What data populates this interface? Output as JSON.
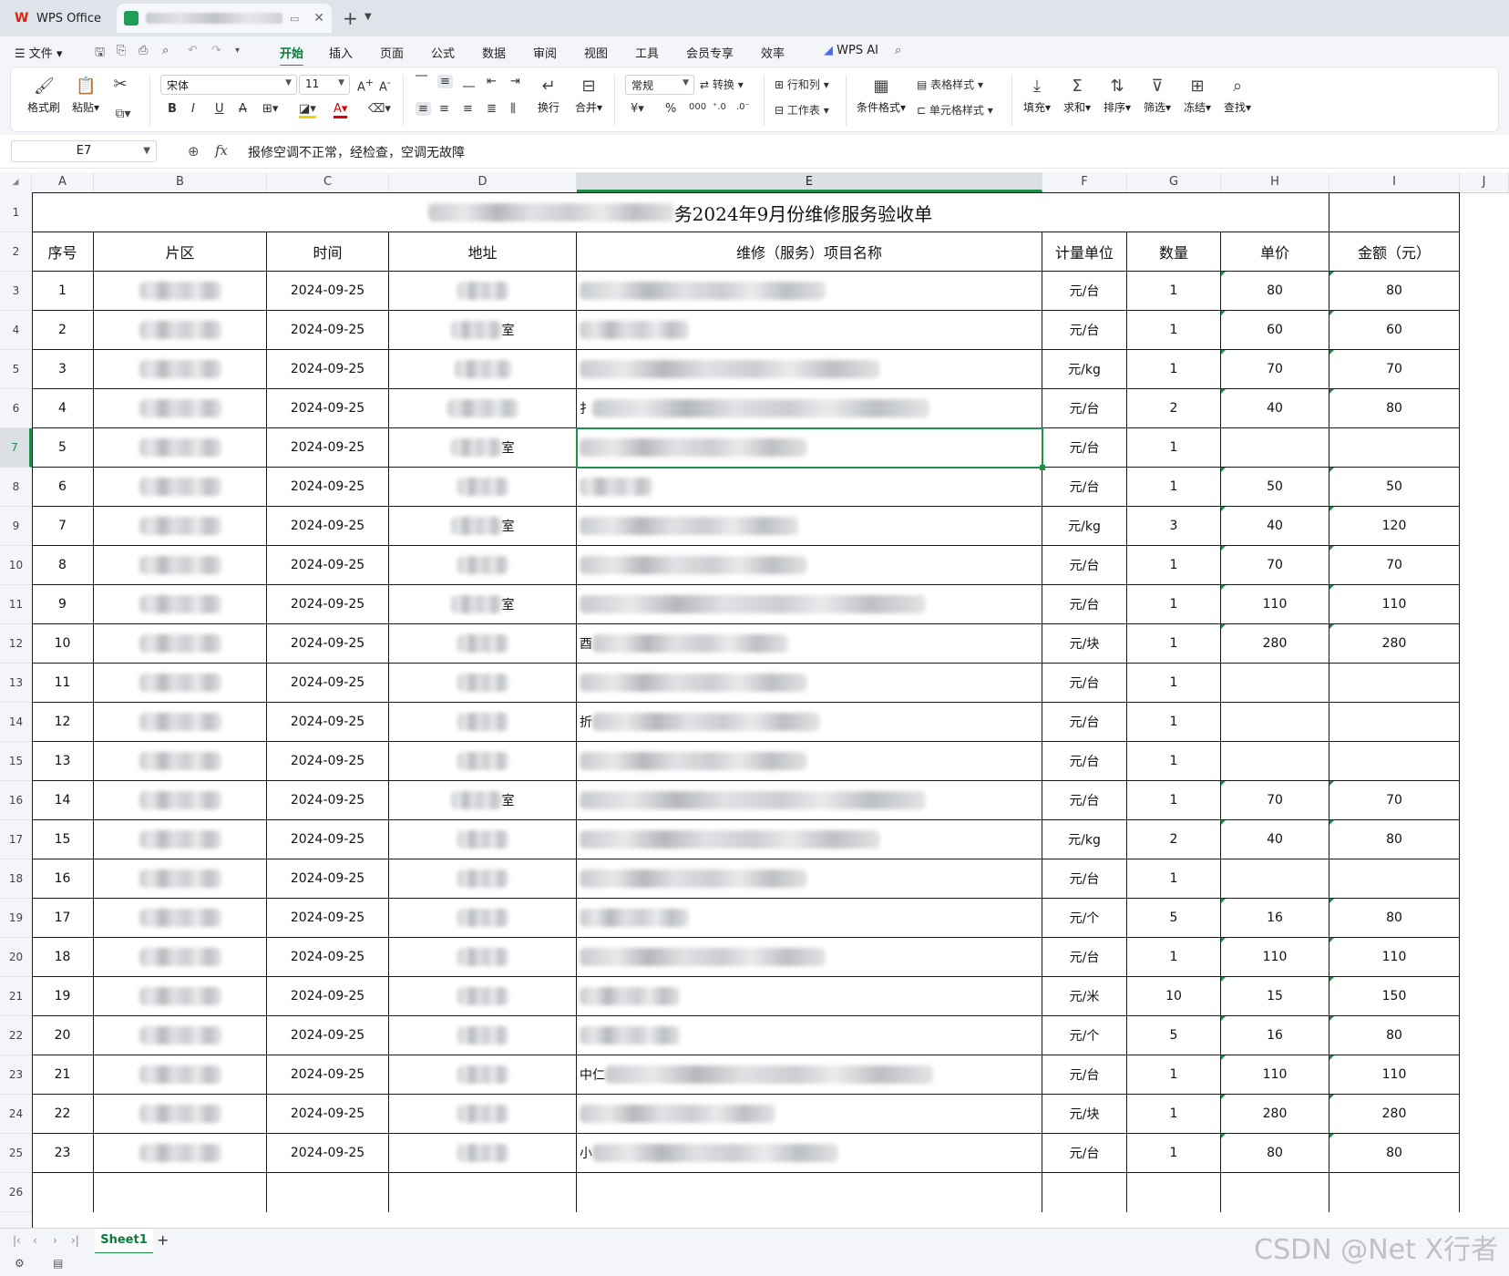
{
  "tabs": {
    "app": "WPS Office"
  },
  "menu": [
    "文件",
    "开始",
    "插入",
    "页面",
    "公式",
    "数据",
    "审阅",
    "视图",
    "工具",
    "会员专享",
    "效率",
    "WPS AI"
  ],
  "ribbon": {
    "format_painter": "格式刷",
    "paste": "粘贴",
    "font_name": "宋体",
    "font_size": "11",
    "wrap": "换行",
    "merge": "合并",
    "number_format": "常规",
    "convert": "转换",
    "rows_cols": "行和列",
    "worksheet": "工作表",
    "cond_format": "条件格式",
    "table_style": "表格样式",
    "cell_style": "单元格样式",
    "fill": "填充",
    "sum": "求和",
    "sort": "排序",
    "filter": "筛选",
    "freeze": "冻结",
    "find": "查找"
  },
  "formula": {
    "cell": "E7",
    "content": "报修空调不正常，经检查，空调无故障"
  },
  "columns": [
    "A",
    "B",
    "C",
    "D",
    "E",
    "F",
    "G",
    "H",
    "I",
    "J"
  ],
  "sheet": {
    "title_visible": "务2024年9月份维修服务验收单",
    "headers": [
      "序号",
      "片区",
      "时间",
      "地址",
      "维修（服务）项目名称",
      "计量单位",
      "数量",
      "单价",
      "金额（元）"
    ],
    "rows": [
      {
        "n": "1",
        "date": "2024-09-25",
        "unit": "元/台",
        "qty": "1",
        "price": "80",
        "amount": "80"
      },
      {
        "n": "2",
        "date": "2024-09-25",
        "unit": "元/台",
        "qty": "1",
        "price": "60",
        "amount": "60"
      },
      {
        "n": "3",
        "date": "2024-09-25",
        "unit": "元/kg",
        "qty": "1",
        "price": "70",
        "amount": "70"
      },
      {
        "n": "4",
        "date": "2024-09-25",
        "unit": "元/台",
        "qty": "2",
        "price": "40",
        "amount": "80"
      },
      {
        "n": "5",
        "date": "2024-09-25",
        "unit": "元/台",
        "qty": "1",
        "price": "",
        "amount": ""
      },
      {
        "n": "6",
        "date": "2024-09-25",
        "unit": "元/台",
        "qty": "1",
        "price": "50",
        "amount": "50"
      },
      {
        "n": "7",
        "date": "2024-09-25",
        "unit": "元/kg",
        "qty": "3",
        "price": "40",
        "amount": "120"
      },
      {
        "n": "8",
        "date": "2024-09-25",
        "unit": "元/台",
        "qty": "1",
        "price": "70",
        "amount": "70"
      },
      {
        "n": "9",
        "date": "2024-09-25",
        "unit": "元/台",
        "qty": "1",
        "price": "110",
        "amount": "110"
      },
      {
        "n": "10",
        "date": "2024-09-25",
        "unit": "元/块",
        "qty": "1",
        "price": "280",
        "amount": "280"
      },
      {
        "n": "11",
        "date": "2024-09-25",
        "unit": "元/台",
        "qty": "1",
        "price": "",
        "amount": ""
      },
      {
        "n": "12",
        "date": "2024-09-25",
        "unit": "元/台",
        "qty": "1",
        "price": "",
        "amount": ""
      },
      {
        "n": "13",
        "date": "2024-09-25",
        "unit": "元/台",
        "qty": "1",
        "price": "",
        "amount": ""
      },
      {
        "n": "14",
        "date": "2024-09-25",
        "unit": "元/台",
        "qty": "1",
        "price": "70",
        "amount": "70"
      },
      {
        "n": "15",
        "date": "2024-09-25",
        "unit": "元/kg",
        "qty": "2",
        "price": "40",
        "amount": "80"
      },
      {
        "n": "16",
        "date": "2024-09-25",
        "unit": "元/台",
        "qty": "1",
        "price": "",
        "amount": ""
      },
      {
        "n": "17",
        "date": "2024-09-25",
        "unit": "元/个",
        "qty": "5",
        "price": "16",
        "amount": "80"
      },
      {
        "n": "18",
        "date": "2024-09-25",
        "unit": "元/台",
        "qty": "1",
        "price": "110",
        "amount": "110"
      },
      {
        "n": "19",
        "date": "2024-09-25",
        "unit": "元/米",
        "qty": "10",
        "price": "15",
        "amount": "150"
      },
      {
        "n": "20",
        "date": "2024-09-25",
        "unit": "元/个",
        "qty": "5",
        "price": "16",
        "amount": "80"
      },
      {
        "n": "21",
        "date": "2024-09-25",
        "unit": "元/台",
        "qty": "1",
        "price": "110",
        "amount": "110"
      },
      {
        "n": "22",
        "date": "2024-09-25",
        "unit": "元/块",
        "qty": "1",
        "price": "280",
        "amount": "280"
      },
      {
        "n": "23",
        "date": "2024-09-25",
        "unit": "元/台",
        "qty": "1",
        "price": "80",
        "amount": "80"
      }
    ],
    "address_fragments": {
      "4": "室",
      "7": "室",
      "9": "室",
      "11": "室",
      "16": "室"
    },
    "item_fragments": {
      "6": "扌",
      "12": "酉",
      "14": "折",
      "23": "中仁",
      "25": "小"
    }
  },
  "sheet_tab": "Sheet1",
  "watermark": "CSDN @Net X行者"
}
